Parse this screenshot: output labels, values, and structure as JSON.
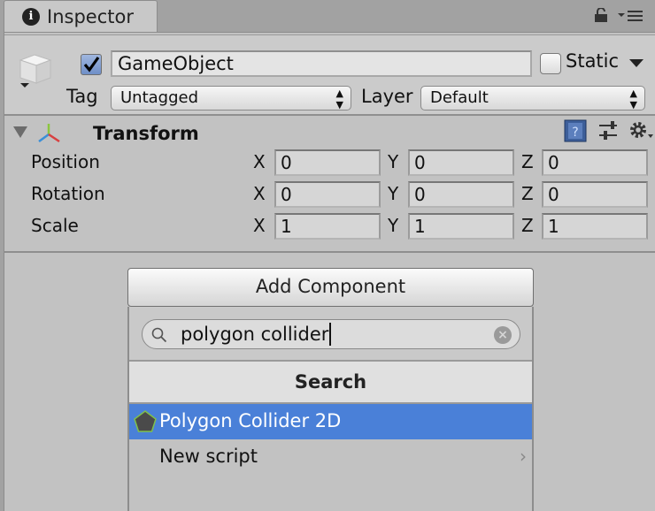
{
  "tab": {
    "label": "Inspector",
    "icon": "info-icon"
  },
  "toolbar": {
    "lock_icon": "lock-icon",
    "menu_icon": "menu-icon"
  },
  "gameobject": {
    "active": true,
    "name": "GameObject",
    "static_label": "Static",
    "static_checked": false,
    "tag_label": "Tag",
    "tag_value": "Untagged",
    "layer_label": "Layer",
    "layer_value": "Default"
  },
  "transform": {
    "title": "Transform",
    "rows": [
      {
        "label": "Position",
        "x": "0",
        "y": "0",
        "z": "0"
      },
      {
        "label": "Rotation",
        "x": "0",
        "y": "0",
        "z": "0"
      },
      {
        "label": "Scale",
        "x": "1",
        "y": "1",
        "z": "1"
      }
    ],
    "axes": {
      "x": "X",
      "y": "Y",
      "z": "Z"
    }
  },
  "add_component": {
    "button_label": "Add Component",
    "search_value": "polygon collider",
    "section_title": "Search",
    "results": [
      {
        "label": "Polygon Collider 2D",
        "selected": true,
        "icon": "polygon-collider-icon"
      },
      {
        "label": "New script",
        "selected": false,
        "has_submenu": true
      }
    ]
  },
  "colors": {
    "selection": "#4a80d8",
    "panel": "#c2c2c2"
  }
}
